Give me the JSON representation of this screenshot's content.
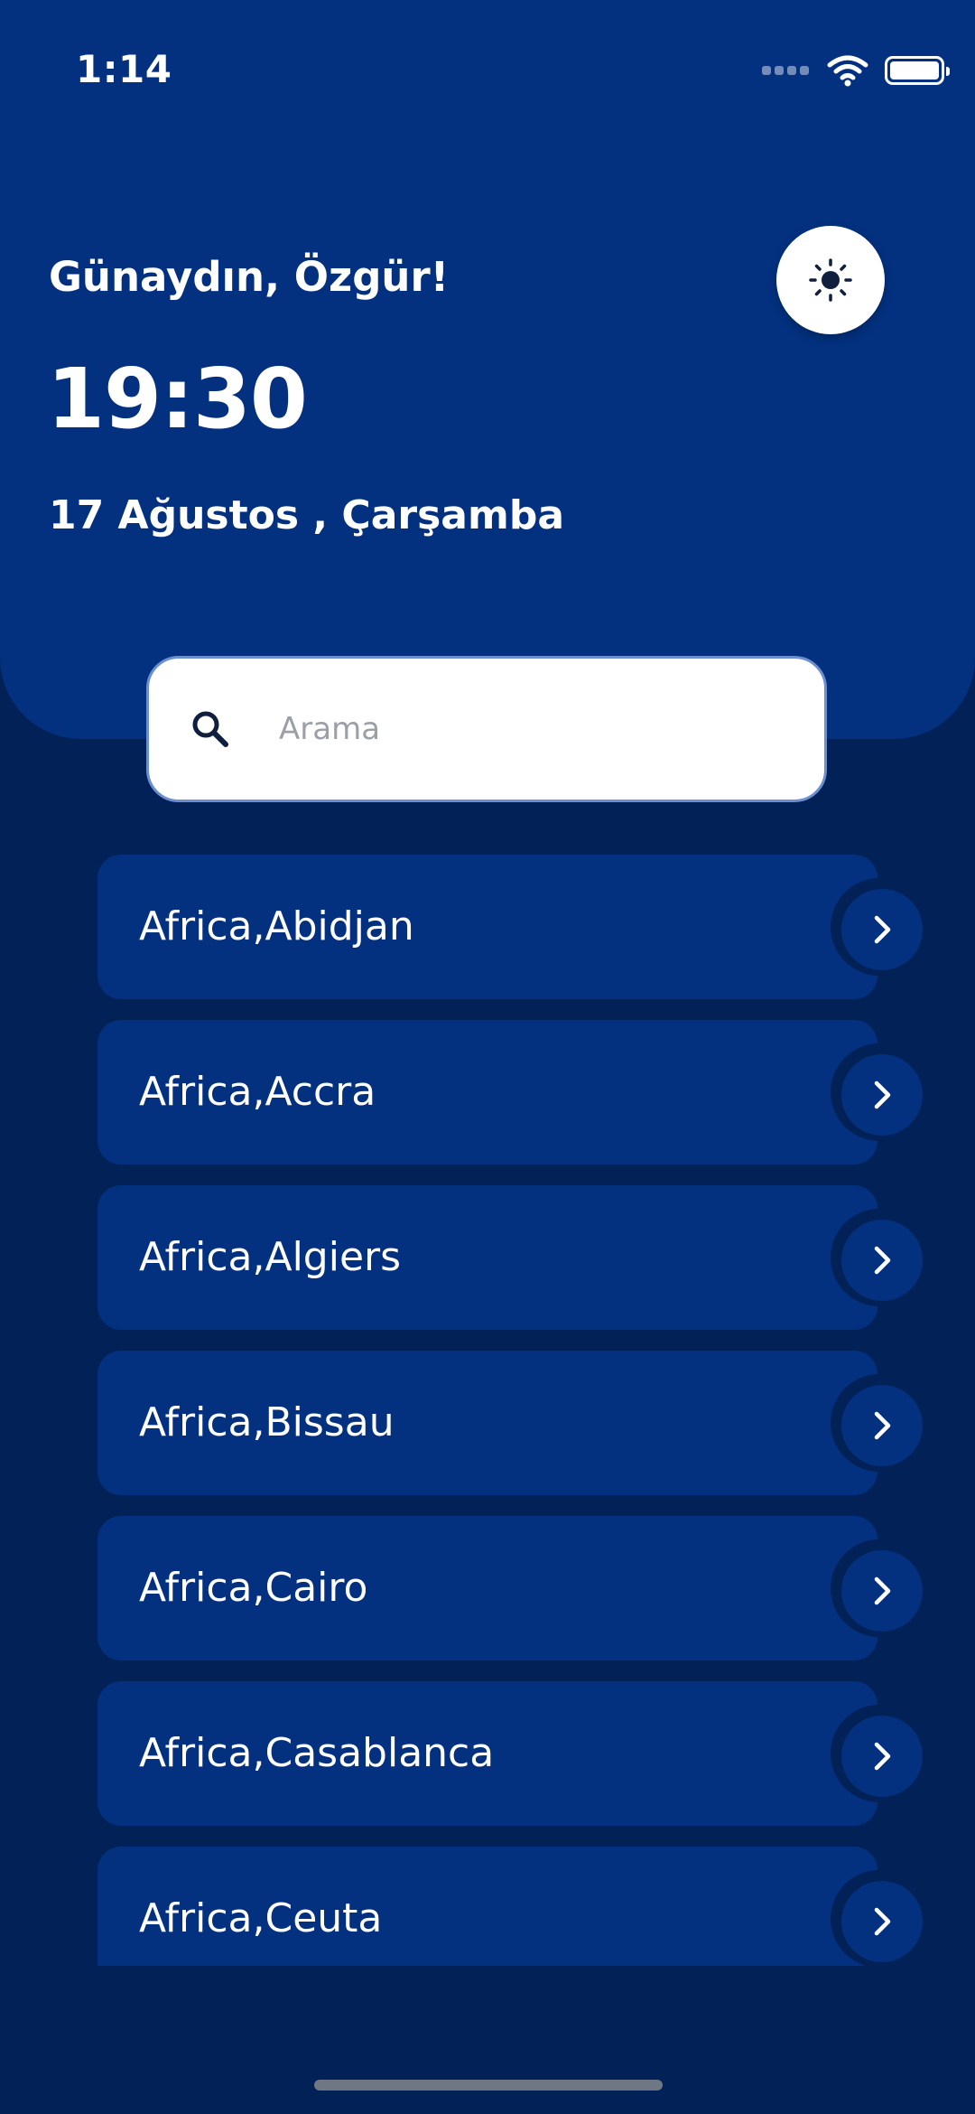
{
  "status_bar": {
    "time": "1:14"
  },
  "header": {
    "greeting": "Günaydın, Özgür!",
    "clock": "19:30",
    "date": "17 Ağustos , Çarşamba",
    "theme_toggle_icon": "sun-icon"
  },
  "search": {
    "placeholder": "Arama",
    "value": ""
  },
  "cities": [
    {
      "label": "Africa,Abidjan"
    },
    {
      "label": "Africa,Accra"
    },
    {
      "label": "Africa,Algiers"
    },
    {
      "label": "Africa,Bissau"
    },
    {
      "label": "Africa,Cairo"
    },
    {
      "label": "Africa,Casablanca"
    },
    {
      "label": "Africa,Ceuta"
    }
  ],
  "colors": {
    "background": "#012157",
    "header": "#03317f",
    "card": "#03317f",
    "text": "#ffffff",
    "search_background": "#ffffff"
  }
}
